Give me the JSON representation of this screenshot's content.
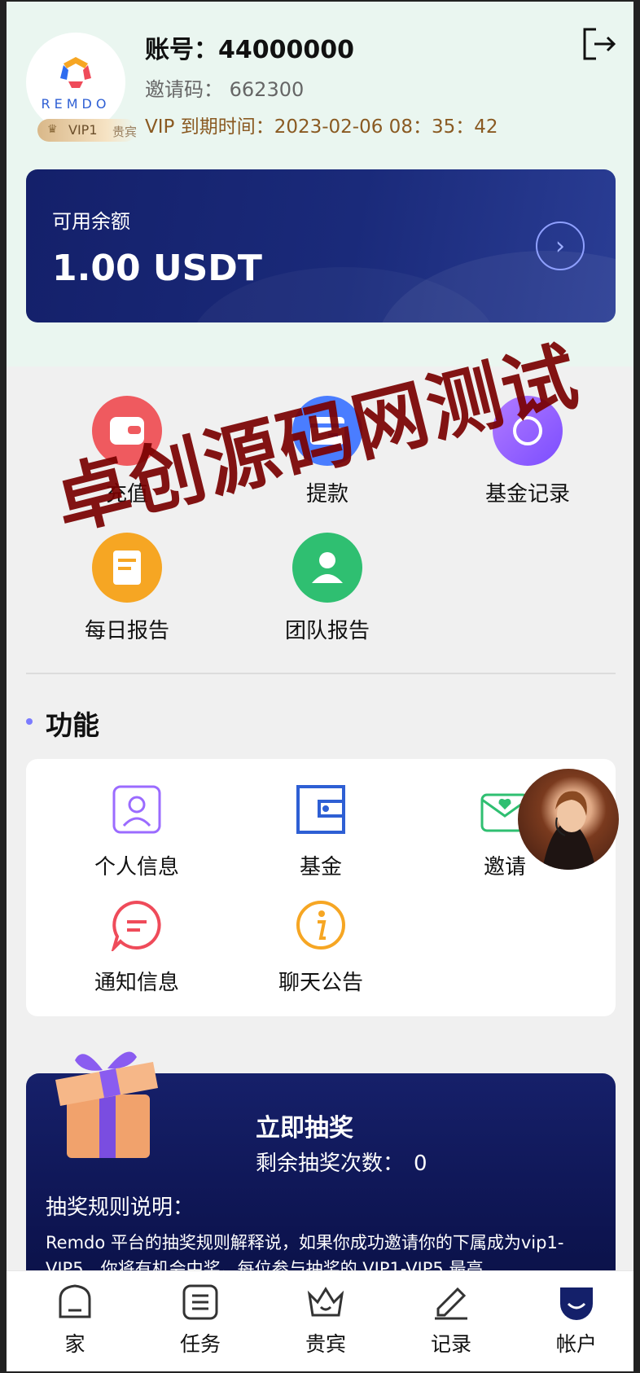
{
  "header": {
    "logo_text": "REMDO",
    "vip_level": "VIP1",
    "vip_word": "贵宾",
    "account_label": "账号：",
    "account_value": "44000000",
    "invite_label": "邀请码：",
    "invite_value": "662300",
    "vip_expiry_label": "VIP 到期时间：",
    "vip_expiry_value": "2023-02-06 08：35：42"
  },
  "balance": {
    "label": "可用余额",
    "value": "1.00 USDT"
  },
  "quick_actions": [
    {
      "label": "充值",
      "icon": "wallet-icon",
      "color": "#ef5a5f"
    },
    {
      "label": "提款",
      "icon": "card-icon",
      "color": "#4a7dff"
    },
    {
      "label": "基金记录",
      "icon": "record-icon",
      "color": "#8b5cf6"
    },
    {
      "label": "每日报告",
      "icon": "report-icon",
      "color": "#f6a623"
    },
    {
      "label": "团队报告",
      "icon": "team-icon",
      "color": "#2fbf71"
    }
  ],
  "features": {
    "title": "功能",
    "items": [
      {
        "label": "个人信息",
        "icon": "profile-icon"
      },
      {
        "label": "基金",
        "icon": "fund-icon"
      },
      {
        "label": "邀请",
        "icon": "invite-icon"
      },
      {
        "label": "通知信息",
        "icon": "message-icon"
      },
      {
        "label": "聊天公告",
        "icon": "info-icon"
      }
    ]
  },
  "lottery": {
    "title": "立即抽奖",
    "count_label": "剩余抽奖次数：",
    "count_value": "0",
    "rules_title": "抽奖规则说明：",
    "rules_text": "Remdo 平台的抽奖规则解释说，如果你成功邀请你的下属成为vip1-VIP5，你将有机会中奖。每位参与抽奖的 VIP1-VIP5 最高"
  },
  "nav": [
    {
      "label": "家",
      "icon": "home-icon"
    },
    {
      "label": "任务",
      "icon": "task-icon"
    },
    {
      "label": "贵宾",
      "icon": "crown-icon"
    },
    {
      "label": "记录",
      "icon": "edit-icon"
    },
    {
      "label": "帐户",
      "icon": "account-icon"
    }
  ],
  "watermark": "卓创源码网测试",
  "colors": {
    "header_bg": "#eaf6f0",
    "balance_bg": "#14206a",
    "vip_text": "#8a5a22",
    "accent": "#7b7bff"
  }
}
